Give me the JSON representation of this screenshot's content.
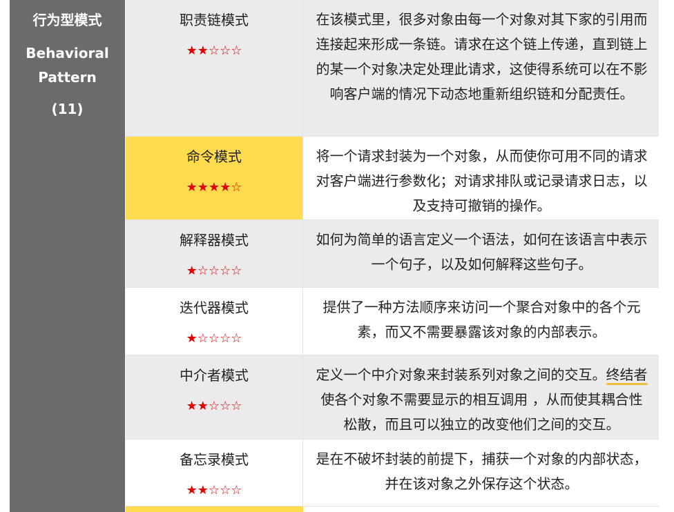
{
  "category": {
    "title_cn": "行为型模式",
    "title_en": "Behavioral Pattern",
    "count": "(11)"
  },
  "patterns": [
    {
      "name": "职责链模式",
      "rating": 2,
      "stars": "★★☆☆☆",
      "description": "在该模式里，很多对象由每一个对象对其下家的引用而连接起来形成一条链。请求在这个链上传递，直到链上的某一个对象决定处理此请求，这使得系统可以在不影响客户端的情况下动态地重新组织链和分配责任。"
    },
    {
      "name": "命令模式",
      "rating": 4,
      "stars": "★★★★☆",
      "description": "将一个请求封装为一个对象，从而使你可用不同的请求对客户端进行参数化；对请求排队或记录请求日志，以及支持可撤销的操作。"
    },
    {
      "name": "解释器模式",
      "rating": 1,
      "stars": "★☆☆☆☆",
      "description": "如何为简单的语言定义一个语法，如何在该语言中表示一个句子，以及如何解释这些句子。"
    },
    {
      "name": "迭代器模式",
      "rating": 1,
      "stars": "★☆☆☆☆",
      "description": "提供了一种方法顺序来访问一个聚合对象中的各个元素，而又不需要暴露该对象的内部表示。"
    },
    {
      "name": "中介者模式",
      "rating": 2,
      "stars": "★★☆☆☆",
      "description_a": "定义一个中介对象来封装系列对象之间的交互。",
      "description_u": "终结者",
      "description_b": "使各个对象不需要显示的相互调用 ，从而使其耦合性松散，而且可以独立的改变他们之间的交互。"
    },
    {
      "name": "备忘录模式",
      "rating": 2,
      "stars": "★★☆☆☆",
      "description": "是在不破坏封装的前提下，捕获一个对象的内部状态，并在该对象之外保存这个状态。"
    }
  ],
  "colors": {
    "category_bg": "#6b6b6b",
    "highlight": "#ffdb4d",
    "row_gray": "#ebebeb",
    "star": "#e00000"
  }
}
